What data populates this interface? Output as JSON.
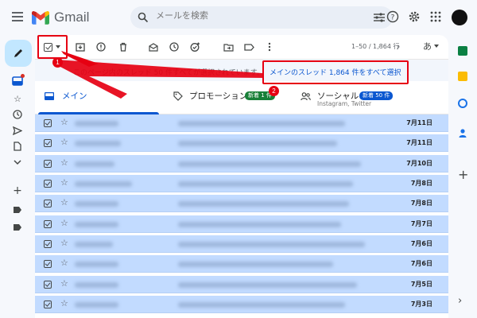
{
  "header": {
    "logo_text": "Gmail",
    "search_placeholder": "メールを検索"
  },
  "toolbar": {
    "pager_text": "1–50 / 1,864 行",
    "lang_label": "あ"
  },
  "banner": {
    "text": "このページ内のスレッド 50 件すべてが選択されています。",
    "link": "メインのスレッド 1,864 件をすべて選択"
  },
  "tabs": [
    {
      "label": "メイン"
    },
    {
      "label": "プロモーション",
      "badge": "新着 1 件"
    },
    {
      "label": "ソーシャル",
      "badge": "新着 50 件",
      "sub": "Instagram, Twitter"
    }
  ],
  "rows": [
    {
      "date": "7月11日"
    },
    {
      "date": "7月11日"
    },
    {
      "date": "7月10日"
    },
    {
      "date": "7月8日"
    },
    {
      "date": "7月8日"
    },
    {
      "date": "7月7日"
    },
    {
      "date": "7月6日"
    },
    {
      "date": "7月6日"
    },
    {
      "date": "7月5日"
    },
    {
      "date": "7月3日"
    }
  ],
  "annotations": {
    "marker1": "1",
    "marker2": "2",
    "color": "#e60012"
  },
  "colors": {
    "accent": "#0b57d0",
    "promotions_badge": "#188038",
    "social_badge": "#0b57d0",
    "selected_row": "#c2dbff"
  }
}
